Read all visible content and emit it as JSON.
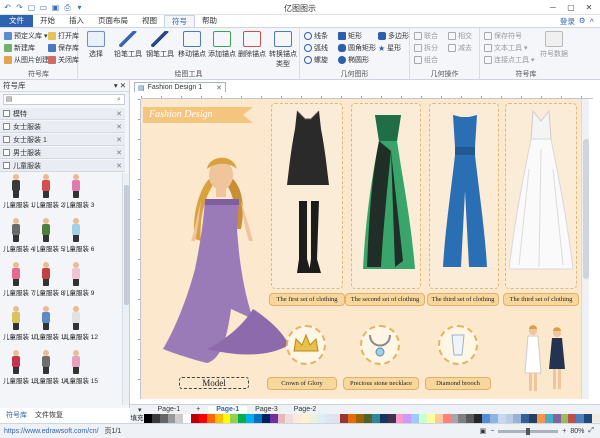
{
  "window": {
    "title": "亿图图示"
  },
  "tabs": [
    "文件",
    "开始",
    "插入",
    "页面布局",
    "视图",
    "符号",
    "帮助"
  ],
  "active_tab": "符号",
  "account": {
    "login": "登录"
  },
  "ribbon": {
    "library_group": {
      "label": "符号库",
      "items": [
        "预定义库",
        "新建库",
        "从图片创建",
        "打开库",
        "保存库",
        "关闭库"
      ]
    },
    "draw_group": {
      "label": "绘图工具",
      "items": [
        "选择",
        "铅笔工具",
        "钢笔工具",
        "移动锚点",
        "添加锚点",
        "删除锚点",
        "转换锚点类型"
      ]
    },
    "geometry_group": {
      "label": "几何图形",
      "items": [
        "线条",
        "弧线",
        "螺旋",
        "矩形",
        "圆角矩形",
        "椭圆形",
        "多边形",
        "星形"
      ]
    },
    "geo_ops_group": {
      "label": "几何操作",
      "items": [
        "联合",
        "拆分",
        "组合",
        "相交",
        "减去"
      ]
    },
    "symbol_group": {
      "label": "符号库",
      "items": [
        "保存符号",
        "文本工具",
        "连接点工具",
        "符号数据"
      ]
    }
  },
  "library_panel": {
    "title": "符号库",
    "search_placeholder": "",
    "categories": [
      "模特",
      "女士服装",
      "女士服装 1",
      "男士服装",
      "儿童服装"
    ],
    "symbols": [
      "儿童服装 1",
      "儿童服装 2",
      "儿童服装 3",
      "儿童服装 4",
      "儿童服装 5",
      "儿童服装 6",
      "儿童服装 7",
      "儿童服装 8",
      "儿童服装 9",
      "儿童服装 10",
      "儿童服装 11",
      "儿童服装 12",
      "儿童服装 13",
      "儿童服装 14",
      "儿童服装 15"
    ],
    "footer_tabs": [
      "符号库",
      "文件恢复"
    ]
  },
  "document": {
    "tab_title": "Fashion Design 1",
    "banner": "Fashion Design",
    "model_label": "Model",
    "clothing_captions": [
      "The first set of clothing",
      "The second set of clothing",
      "The third set of clothing",
      "The third set of clothing"
    ],
    "accessory_captions": [
      "Crown of Glory",
      "Precious stone necklace",
      "Diamond brooch"
    ]
  },
  "pages": {
    "tabs": [
      "Page-1",
      "Page-1",
      "Page-3",
      "Page-2"
    ],
    "active_index": 1
  },
  "palette": {
    "label": "填充",
    "colors": [
      "#000000",
      "#3a3a3a",
      "#666666",
      "#999999",
      "#cccccc",
      "#ffffff",
      "#c00000",
      "#ff0000",
      "#ff6600",
      "#ffc000",
      "#ffff00",
      "#92d050",
      "#00b050",
      "#00b0f0",
      "#0070c0",
      "#002060",
      "#7030a0",
      "#e6b8b7",
      "#f2dcdb",
      "#fde9d9",
      "#fff2cc",
      "#ebf1de",
      "#dbeef4",
      "#dce6f2",
      "#e5e0ec",
      "#963634",
      "#e26b0a",
      "#9c6500",
      "#4f6228",
      "#31869b",
      "#16365c",
      "#403151",
      "#ff99cc",
      "#cc99ff",
      "#99ccff",
      "#ccffcc",
      "#ffff99",
      "#ffcc99",
      "#ff8080",
      "#a6a6a6",
      "#7f7f7f",
      "#595959",
      "#262626",
      "#548dd4",
      "#8db3e2",
      "#c6d9f0",
      "#b8cce4",
      "#95b3d7",
      "#366092",
      "#244062",
      "#f79646",
      "#4bacc6",
      "#8064a2",
      "#9bbb59",
      "#c0504d",
      "#4f81bd",
      "#1f497d",
      "#eeece1"
    ]
  },
  "status": {
    "url": "https://www.edrawsoft.com/cn/",
    "page": "页1/1",
    "zoom": "80%"
  }
}
